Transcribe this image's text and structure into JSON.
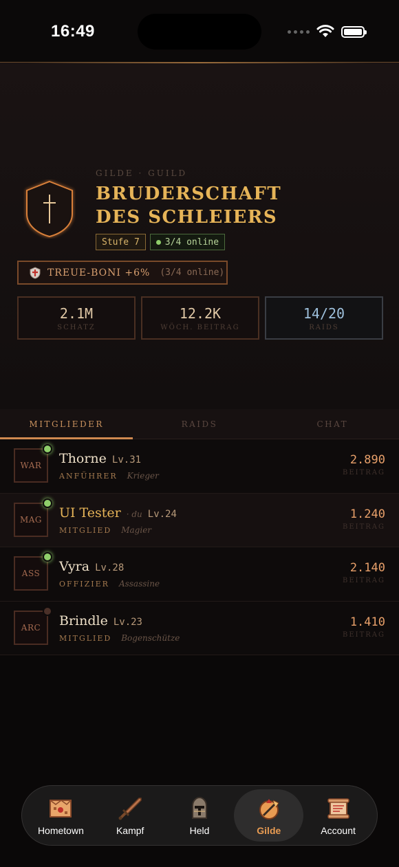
{
  "status": {
    "time": "16:49"
  },
  "guild": {
    "eyebrow": "GILDE · GUILD",
    "title_line1": "BRUDERSCHAFT",
    "title_line2": "DES SCHLEIERS",
    "level": "Stufe 7",
    "online": "3/4 online",
    "bonus_label": "TREUE-BONI +6%",
    "bonus_sub": "(3/4 online)",
    "stats": [
      {
        "value": "2.1M",
        "label": "SCHATZ"
      },
      {
        "value": "12.2K",
        "label": "WÖCH. BEITRAG"
      },
      {
        "value": "14/20",
        "label": "RAIDS"
      }
    ]
  },
  "tabs": [
    "MITGLIEDER",
    "RAIDS",
    "CHAT"
  ],
  "members": [
    {
      "cls": "WAR",
      "name": "Thorne",
      "du": "",
      "level": "Lv.31",
      "role": "ANFÜHRER",
      "class": "Krieger",
      "contrib": "2.890",
      "contrib_label": "BEITRAG",
      "online": true
    },
    {
      "cls": "MAG",
      "name": "UI Tester",
      "du": "· du",
      "level": "Lv.24",
      "role": "MITGLIED",
      "class": "Magier",
      "contrib": "1.240",
      "contrib_label": "BEITRAG",
      "online": true
    },
    {
      "cls": "ASS",
      "name": "Vyra",
      "du": "",
      "level": "Lv.28",
      "role": "OFFIZIER",
      "class": "Assassine",
      "contrib": "2.140",
      "contrib_label": "BEITRAG",
      "online": true
    },
    {
      "cls": "ARC",
      "name": "Brindle",
      "du": "",
      "level": "Lv.23",
      "role": "MITGLIED",
      "class": "Bogenschütze",
      "contrib": "1.410",
      "contrib_label": "BEITRAG",
      "online": false
    }
  ],
  "nav": [
    {
      "label": "Hometown",
      "icon": "map-icon"
    },
    {
      "label": "Kampf",
      "icon": "sword-icon"
    },
    {
      "label": "Held",
      "icon": "helmet-icon"
    },
    {
      "label": "Gilde",
      "icon": "guild-crest-icon",
      "active": true
    },
    {
      "label": "Account",
      "icon": "scroll-icon"
    }
  ],
  "colors": {
    "accent": "#e6b458",
    "online": "#8fcf6a",
    "contrib": "#e8a06a",
    "nav_active": "#e89b52"
  }
}
